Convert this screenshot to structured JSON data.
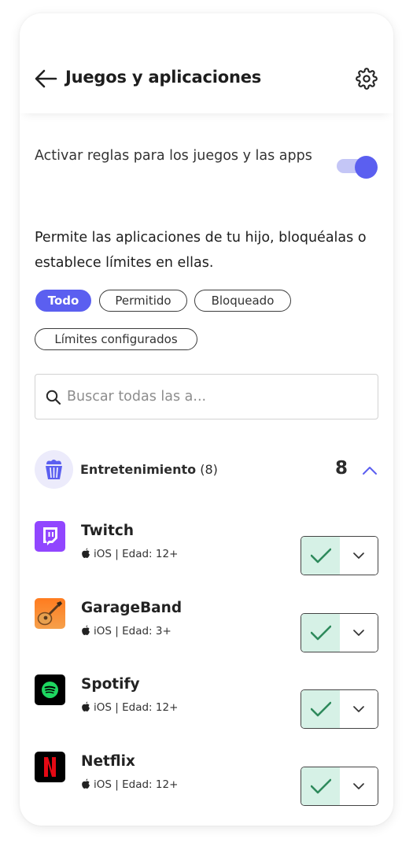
{
  "header": {
    "title": "Juegos y aplicaciones",
    "back_icon": "arrow-left-icon",
    "settings_icon": "gear-icon"
  },
  "rules": {
    "toggle_label": "Activar reglas para los juegos y las apps",
    "toggle_on": true,
    "description": "Permite las aplicaciones de tu hijo, bloquéalas o establece límites en ellas."
  },
  "filters": [
    {
      "label": "Todo",
      "active": true
    },
    {
      "label": "Permitido",
      "active": false
    },
    {
      "label": "Bloqueado",
      "active": false
    },
    {
      "label": "Límites configurados",
      "active": false
    }
  ],
  "search": {
    "placeholder": "Buscar todas las a...",
    "value": ""
  },
  "category": {
    "name": "Entretenimiento",
    "count_label": "(8)",
    "count": "8",
    "icon": "popcorn-icon",
    "expanded": true
  },
  "apps": [
    {
      "name": "Twitch",
      "platform": "iOS",
      "separator": "|",
      "age": "Edad: 12+",
      "status": "allowed",
      "icon": "twitch-icon"
    },
    {
      "name": "GarageBand",
      "platform": "iOS",
      "separator": "|",
      "age": "Edad: 3+",
      "status": "allowed",
      "icon": "garageband-icon"
    },
    {
      "name": "Spotify",
      "platform": "iOS",
      "separator": "|",
      "age": "Edad: 12+",
      "status": "allowed",
      "icon": "spotify-icon"
    },
    {
      "name": "Netflix",
      "platform": "iOS",
      "separator": "|",
      "age": "Edad: 12+",
      "status": "allowed",
      "icon": "netflix-icon"
    }
  ],
  "colors": {
    "accent": "#5b5ff0",
    "toggle_track": "#c4c6f6",
    "allowed_bg": "#d6f1e6",
    "check": "#2e8a5c",
    "category_icon_bg": "#ecebfb"
  }
}
